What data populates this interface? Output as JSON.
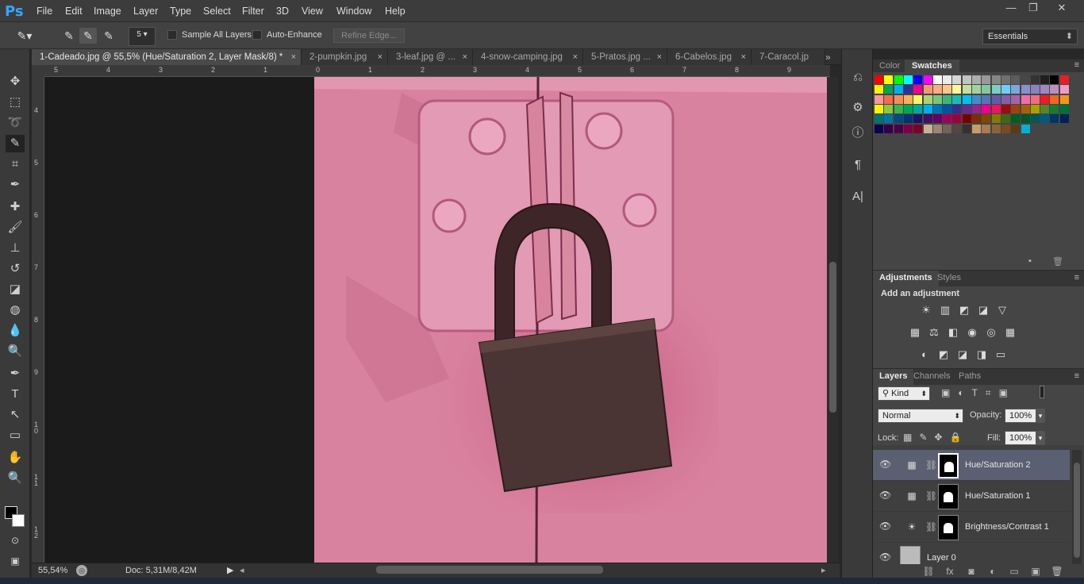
{
  "app": {
    "logo": "Ps",
    "menus": [
      "File",
      "Edit",
      "Image",
      "Layer",
      "Type",
      "Select",
      "Filter",
      "3D",
      "View",
      "Window",
      "Help"
    ],
    "window_buttons": [
      "—",
      "❐",
      "✕"
    ]
  },
  "options": {
    "brush_size": "5",
    "sample_all_layers": "Sample All Layers",
    "auto_enhance": "Auto-Enhance",
    "refine_edge": "Refine Edge...",
    "workspace": "Essentials"
  },
  "tabs": [
    {
      "label": "1-Cadeado.jpg @ 55,5% (Hue/Saturation 2, Layer Mask/8) *",
      "close": "×"
    },
    {
      "label": "2-pumpkin.jpg",
      "close": "×"
    },
    {
      "label": "3-leaf.jpg @ ...",
      "close": "×"
    },
    {
      "label": "4-snow-camping.jpg",
      "close": "×"
    },
    {
      "label": "5-Pratos.jpg ...",
      "close": "×"
    },
    {
      "label": "6-Cabelos.jpg",
      "close": "×"
    },
    {
      "label": "7-Caracol.jp",
      "close": ""
    }
  ],
  "tabs_overflow": "»",
  "ruler_top": [
    "5",
    "4",
    "3",
    "2",
    "1",
    "0",
    "1",
    "2",
    "3",
    "4",
    "5",
    "6",
    "7",
    "8",
    "9"
  ],
  "ruler_left": [
    "4",
    "5",
    "6",
    "7",
    "8",
    "9",
    "1 0",
    "1 1",
    "1 2"
  ],
  "status": {
    "zoom": "55,54%",
    "doc": "Doc: 5,31M/8,42M"
  },
  "tools": [
    "move-tool",
    "marquee-tool",
    "lasso-tool",
    "quick-selection-tool",
    "crop-tool",
    "eyedropper-tool",
    "healing-brush-tool",
    "brush-tool",
    "clone-stamp-tool",
    "history-brush-tool",
    "eraser-tool",
    "paint-bucket-tool",
    "blur-tool",
    "dodge-tool",
    "pen-tool",
    "type-tool",
    "path-selection-tool",
    "shape-tool",
    "hand-tool",
    "zoom-tool"
  ],
  "tool_glyphs": [
    "✥",
    "⬚",
    "➰",
    "✎",
    "⌗",
    "✒",
    "✚",
    "🖌",
    "⊥",
    "↺",
    "◪",
    "◍",
    "💧",
    "🔍",
    "✒",
    "T",
    "↖",
    "▭",
    "✋",
    "🔍"
  ],
  "swatches_panel": {
    "tabs": [
      "Color",
      "Swatches"
    ],
    "active": "Swatches",
    "menu": "≡"
  },
  "swatches": [
    "#ff0000",
    "#ffff00",
    "#00ff00",
    "#00ffff",
    "#0000ff",
    "#ff00ff",
    "#ffffff",
    "#ebebeb",
    "#d6d6d6",
    "#c2c2c2",
    "#adadad",
    "#999999",
    "#858585",
    "#707070",
    "#5c5c5c",
    "#474747",
    "#333333",
    "#1f1f1f",
    "#000000",
    "#ed1c24",
    "#fff200",
    "#00a651",
    "#00aeef",
    "#2e3192",
    "#ec008c",
    "#f7977a",
    "#f9ad81",
    "#fdc68a",
    "#fff79a",
    "#c4df9b",
    "#a3d39c",
    "#82ca9d",
    "#7bcdc8",
    "#6ecff6",
    "#7ea7d8",
    "#8493ca",
    "#8882be",
    "#a187be",
    "#bc8dbf",
    "#f49ac2",
    "#f6989d",
    "#f26c4f",
    "#f68e55",
    "#fbaf5c",
    "#fff467",
    "#acd372",
    "#7cc576",
    "#3bb878",
    "#1abbb4",
    "#00bff3",
    "#438ccb",
    "#5574b9",
    "#605ca8",
    "#855fa8",
    "#a763a8",
    "#f06eaa",
    "#f26d7d",
    "#ed1c24",
    "#f26522",
    "#f7941d",
    "#fff200",
    "#8dc73f",
    "#39b54a",
    "#00a651",
    "#00a99d",
    "#00aeef",
    "#0072bc",
    "#0054a6",
    "#2e3192",
    "#662d91",
    "#92278f",
    "#ec008c",
    "#ed145b",
    "#9e0b0f",
    "#a0410d",
    "#a36209",
    "#aba000",
    "#598527",
    "#1a7b30",
    "#007236",
    "#00746b",
    "#0076a3",
    "#004b80",
    "#003471",
    "#1b1464",
    "#440e62",
    "#630460",
    "#9e005d",
    "#9e0039",
    "#790000",
    "#7b2e00",
    "#7d4900",
    "#827b00",
    "#406618",
    "#005e20",
    "#005826",
    "#005952",
    "#005b7f",
    "#003663",
    "#002157",
    "#0d004c",
    "#32004b",
    "#4b0049",
    "#7b0046",
    "#7a0026",
    "#c7b299",
    "#998675",
    "#736357",
    "#534741",
    "#37302d",
    "#c69c6d",
    "#a67c52",
    "#8c6239",
    "#754c24",
    "#603913",
    "#00b0d8"
  ],
  "adjustments": {
    "tabs": [
      "Adjustments",
      "Styles"
    ],
    "title": "Add an adjustment",
    "icons": [
      [
        "brightness-contrast-icon",
        "levels-icon",
        "curves-icon",
        "exposure-icon",
        "vibrance-icon"
      ],
      [
        "hue-saturation-icon",
        "color-balance-icon",
        "black-white-icon",
        "photo-filter-icon",
        "channel-mixer-icon",
        "color-lookup-icon"
      ],
      [
        "invert-icon",
        "posterize-icon",
        "threshold-icon",
        "selective-color-icon",
        "gradient-map-icon"
      ]
    ],
    "glyphs": [
      [
        "☀",
        "▥",
        "◩",
        "◪",
        "▽"
      ],
      [
        "▦",
        "⚖",
        "◧",
        "◉",
        "◎",
        "▦"
      ],
      [
        "◐",
        "◩",
        "◪",
        "◨",
        "▭"
      ]
    ]
  },
  "layers_panel": {
    "tabs": [
      "Layers",
      "Channels",
      "Paths"
    ],
    "filter": "Kind",
    "blend": "Normal",
    "opacity_label": "Opacity:",
    "opacity": "100%",
    "lock_label": "Lock:",
    "fill_label": "Fill:",
    "fill": "100%",
    "layers": [
      {
        "name": "Hue/Saturation 2",
        "type": "adjustment",
        "selected": true
      },
      {
        "name": "Hue/Saturation 1",
        "type": "adjustment",
        "selected": false
      },
      {
        "name": "Brightness/Contrast 1",
        "type": "brightness",
        "selected": false
      },
      {
        "name": "Layer 0",
        "type": "pixel",
        "selected": false
      }
    ],
    "footer_icons": [
      "link-icon",
      "fx-icon",
      "mask-icon",
      "adjustment-icon",
      "group-icon",
      "new-layer-icon",
      "trash-icon"
    ],
    "footer_glyphs": [
      "⛓",
      "fx",
      "◙",
      "◐",
      "▭",
      "▣",
      "🗑"
    ]
  },
  "colors": {
    "canvas_pink": "#d67d9b",
    "lock_body": "#4a3433",
    "accent": "#5a6072"
  }
}
